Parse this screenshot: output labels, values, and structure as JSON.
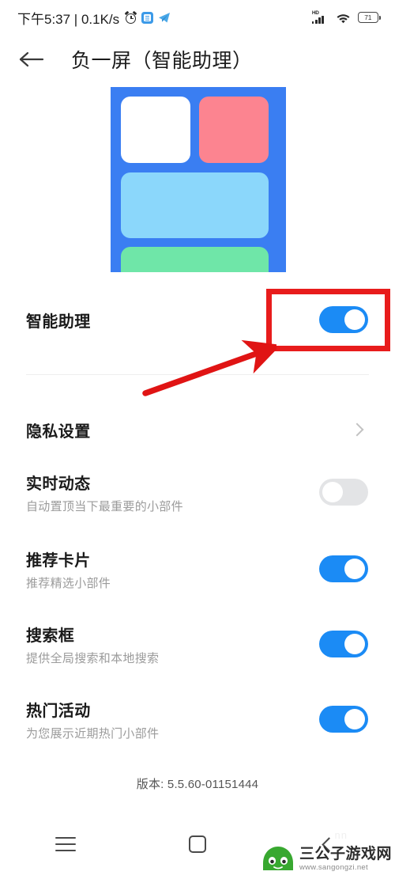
{
  "status_bar": {
    "time": "下午5:37 | 0.1K/s",
    "alarm_icon": "alarm-clock-icon",
    "app_icon_1": "mail-app-icon",
    "app_icon_2": "telegram-app-icon",
    "hd_label": "HD",
    "signal_icon": "cellular-signal-icon",
    "wifi_icon": "wifi-icon",
    "battery_level": "71"
  },
  "header": {
    "back_icon": "back-arrow-icon",
    "title": "负一屏（智能助理）"
  },
  "hero": {
    "name": "assistant-preview-illustration",
    "background_color": "#3a7ef2",
    "cards": [
      {
        "name": "card-white",
        "color": "#ffffff"
      },
      {
        "name": "card-pink",
        "color": "#fc8490"
      },
      {
        "name": "card-blue",
        "color": "#8bd7fb"
      },
      {
        "name": "card-green",
        "color": "#6fe6a8"
      }
    ]
  },
  "settings": {
    "master": {
      "title": "智能助理",
      "toggle_state": "on"
    },
    "privacy": {
      "title": "隐私设置",
      "chevron_icon": "chevron-right-icon"
    },
    "items": [
      {
        "title": "实时动态",
        "subtitle": "自动置顶当下最重要的小部件",
        "toggle_state": "off"
      },
      {
        "title": "推荐卡片",
        "subtitle": "推荐精选小部件",
        "toggle_state": "on"
      },
      {
        "title": "搜索框",
        "subtitle": "提供全局搜索和本地搜索",
        "toggle_state": "on"
      },
      {
        "title": "热门活动",
        "subtitle": "为您展示近期热门小部件",
        "toggle_state": "on"
      }
    ],
    "version": "版本: 5.5.60-01151444"
  },
  "annotation": {
    "color": "#e81c1c",
    "box_label": "highlight-box-around-master-toggle",
    "arrow_label": "pointer-arrow-to-master-toggle"
  },
  "nav_bar": {
    "menu_icon": "menu-icon",
    "home_icon": "home-square-icon",
    "back_icon": "back-chevron-icon"
  },
  "watermark": {
    "site_name": "三公子游戏网",
    "site_url": "www.sangongzi.net",
    "logo_icon": "frog-logo-icon",
    "logo_color": "#38a830"
  },
  "colors": {
    "toggle_on": "#1b8bf5",
    "toggle_off": "#e3e4e6",
    "accent_red": "#e81c1c"
  }
}
